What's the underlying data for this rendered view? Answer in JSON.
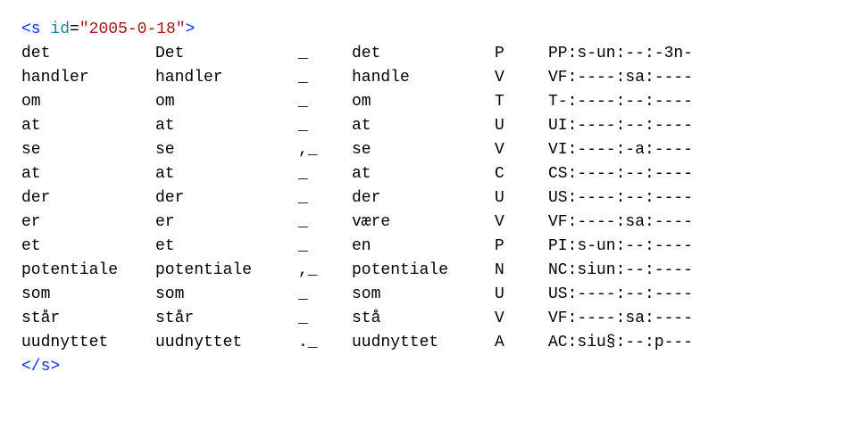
{
  "sentence": {
    "open_prefix": "<s",
    "id_attr_name": "id",
    "eq": "=",
    "id_attr_value": "\"2005-0-18\"",
    "open_suffix": ">",
    "close": "</s>"
  },
  "rows": [
    {
      "c1": "det",
      "c2": "Det",
      "c3": "_",
      "c4": "det",
      "c5": "P",
      "c6": "PP:s-un:--:-3n-"
    },
    {
      "c1": "handler",
      "c2": "handler",
      "c3": "_",
      "c4": "handle",
      "c5": "V",
      "c6": "VF:----:sa:----"
    },
    {
      "c1": "om",
      "c2": "om",
      "c3": "_",
      "c4": "om",
      "c5": "T",
      "c6": "T-:----:--:----"
    },
    {
      "c1": "at",
      "c2": "at",
      "c3": "_",
      "c4": "at",
      "c5": "U",
      "c6": "UI:----:--:----"
    },
    {
      "c1": "se",
      "c2": "se",
      "c3": ",_",
      "c4": "se",
      "c5": "V",
      "c6": "VI:----:-a:----"
    },
    {
      "c1": "at",
      "c2": "at",
      "c3": "_",
      "c4": "at",
      "c5": "C",
      "c6": "CS:----:--:----"
    },
    {
      "c1": "der",
      "c2": "der",
      "c3": "_",
      "c4": "der",
      "c5": "U",
      "c6": "US:----:--:----"
    },
    {
      "c1": "er",
      "c2": "er",
      "c3": "_",
      "c4": "være",
      "c5": "V",
      "c6": "VF:----:sa:----"
    },
    {
      "c1": "et",
      "c2": "et",
      "c3": "_",
      "c4": "en",
      "c5": "P",
      "c6": "PI:s-un:--:----"
    },
    {
      "c1": "potentiale",
      "c2": "potentiale",
      "c3": ",_",
      "c4": "potentiale",
      "c5": "N",
      "c6": "NC:siun:--:----"
    },
    {
      "c1": "som",
      "c2": "som",
      "c3": "_",
      "c4": "som",
      "c5": "U",
      "c6": "US:----:--:----"
    },
    {
      "c1": "står",
      "c2": "står",
      "c3": "_",
      "c4": "stå",
      "c5": "V",
      "c6": "VF:----:sa:----"
    },
    {
      "c1": "uudnyttet",
      "c2": "uudnyttet",
      "c3": "._",
      "c4": "uudnyttet",
      "c5": "A",
      "c6": "AC:siu§:--:p---"
    }
  ]
}
